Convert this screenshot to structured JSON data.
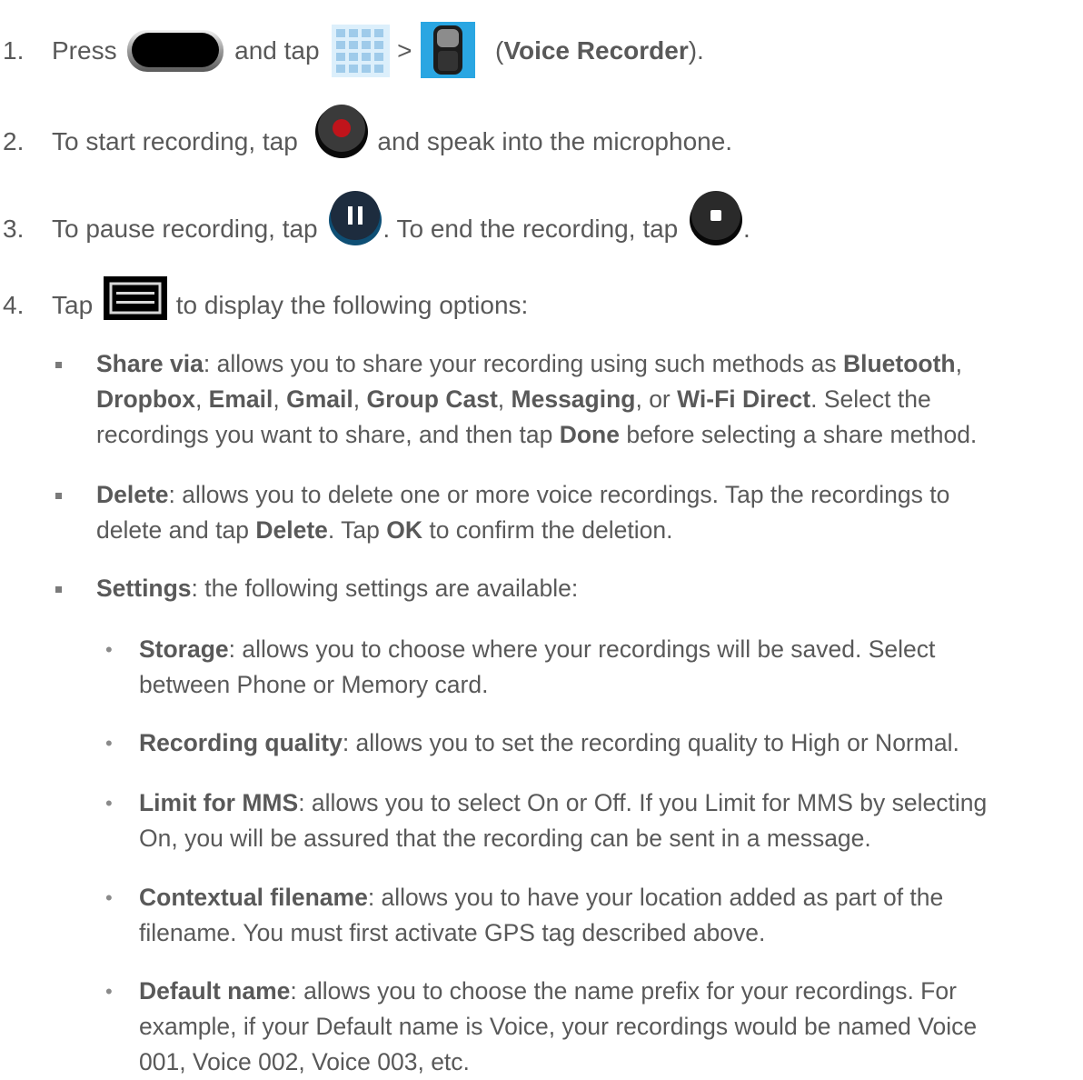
{
  "colors": {
    "text": "#595959",
    "bold": "#595959",
    "record": "#c0141b"
  },
  "steps": [
    {
      "num": "1.",
      "a": "Press",
      "b": "and tap",
      "c": ">",
      "d": "(",
      "e": "Voice Recorder",
      "f": ")."
    },
    {
      "num": "2.",
      "a": "To start recording, tap",
      "b": "and speak into the microphone."
    },
    {
      "num": "3.",
      "a": "To pause recording, tap",
      "b": ". To end the recording, tap",
      "c": "."
    },
    {
      "num": "4.",
      "a": "Tap",
      "b": "to display the following options:"
    }
  ],
  "share": {
    "t": "Share via",
    "s1": ": allows you to share your recording using such methods as ",
    "bluetooth": "Bluetooth",
    "s2": ",",
    "dropbox": "Dropbox",
    "email": "Email",
    "gmail": "Gmail",
    "groupcast": "Group Cast",
    "messaging": "Messaging",
    "wifi": "Wi-Fi Direct",
    "comma": ", ",
    "or": ", or ",
    "s3": ". Select the",
    "l3a": "recordings you want to share, and then tap ",
    "done": "Done",
    "l3b": " before selecting a share method."
  },
  "del": {
    "t": "Delete",
    "s1": ": allows you to delete one or more voice recordings. Tap the recordings to",
    "s2": "delete and tap ",
    "d2": "Delete",
    "s3": ". Tap ",
    "ok": "OK",
    "s4": " to confirm the deletion."
  },
  "settings": {
    "t": "Settings",
    "s1": ": the following settings are available:"
  },
  "sub": [
    {
      "t": "Storage",
      "l1": ": allows you to choose where your recordings will be saved. Select",
      "l2": "between Phone or Memory card."
    },
    {
      "t": "Recording quality",
      "l1": ": allows you to set the recording quality to High or Normal."
    },
    {
      "t": "Limit for MMS",
      "l1": ": allows you to select On or Off. If you Limit for MMS by selecting",
      "l2": "On, you will be assured that the recording can be sent in a message."
    },
    {
      "t": "Contextual filename",
      "l1": ": allows you to have your location added as part of the",
      "l2": "filename. You must first activate GPS tag described above."
    },
    {
      "t": "Default name",
      "l1": ": allows you to choose the name prefix for your recordings. For",
      "l2": "example, if your Default name is Voice, your recordings would be named Voice",
      "l3": "001, Voice 002, Voice 003, etc."
    }
  ],
  "bulletchar": "•",
  "icons": [
    "home-button-icon",
    "apps-grid-icon",
    "voice-recorder-app-icon",
    "record-icon",
    "pause-icon",
    "stop-icon",
    "menu-key-icon"
  ]
}
